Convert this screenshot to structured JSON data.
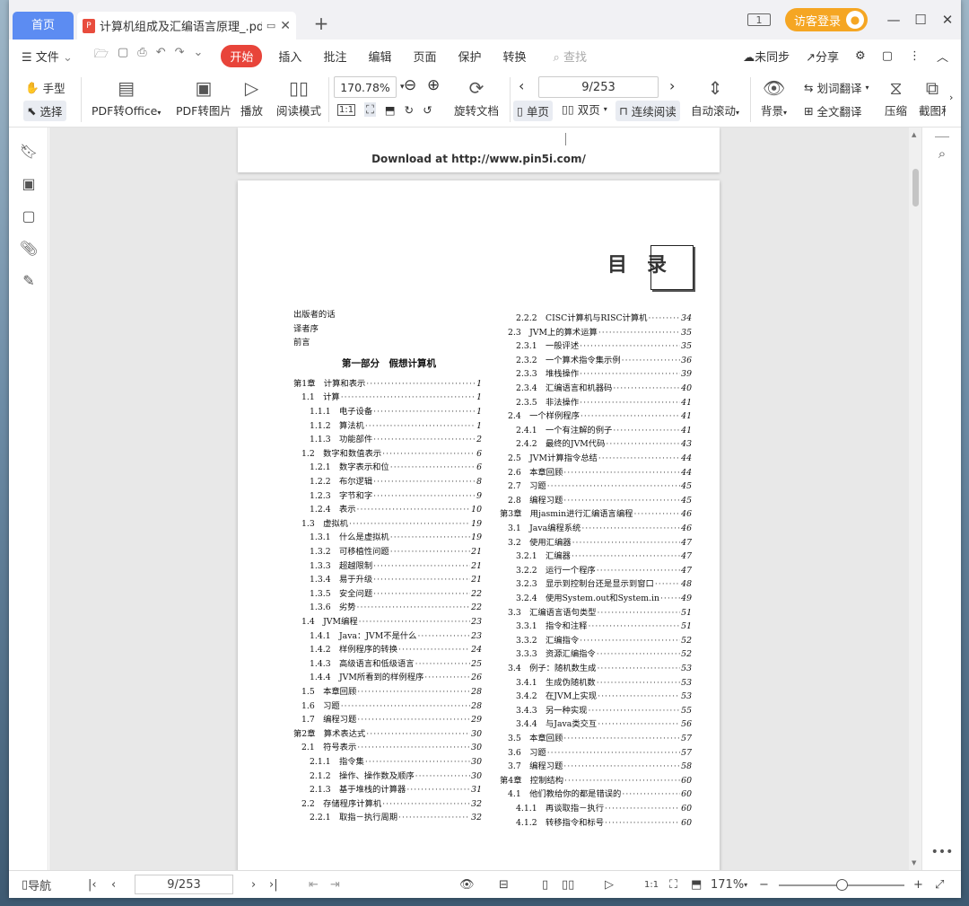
{
  "titlebar": {
    "home_tab": "首页",
    "doc_tab": "计算机组成及汇编语言原理_.pdf",
    "new_tab": "+",
    "page_badge": "1",
    "login": "访客登录"
  },
  "menubar": {
    "file": "文件",
    "start": "开始",
    "items": [
      "插入",
      "批注",
      "编辑",
      "页面",
      "保护",
      "转换"
    ],
    "search": "查找",
    "sync": "未同步",
    "share": "分享"
  },
  "toolbar": {
    "hand": "手型",
    "select": "选择",
    "pdf_to_office": "PDF转Office",
    "pdf_to_image": "PDF转图片",
    "play": "播放",
    "read_mode": "阅读模式",
    "zoom": "170.78%",
    "page": "9/253",
    "rotate": "旋转文档",
    "single": "单页",
    "double": "双页",
    "continuous": "连续阅读",
    "auto_scroll": "自动滚动",
    "background": "背景",
    "word_translate": "划词翻译",
    "full_translate": "全文翻译",
    "compress": "压缩",
    "screenshot": "截图和"
  },
  "document": {
    "prev_page_footer": "Download at http://www.pin5i.com/",
    "heading": "目　录",
    "toc_left": [
      {
        "t": "出版者的话",
        "p": "",
        "i": 0
      },
      {
        "t": "译者序",
        "p": "",
        "i": 0
      },
      {
        "t": "前言",
        "p": "",
        "i": 0
      },
      {
        "t": "第1章　计算和表示",
        "p": "1",
        "i": 0
      },
      {
        "t": "1.1　计算",
        "p": "1",
        "i": 1
      },
      {
        "t": "1.1.1　电子设备",
        "p": "1",
        "i": 2
      },
      {
        "t": "1.1.2　算法机",
        "p": "1",
        "i": 2
      },
      {
        "t": "1.1.3　功能部件",
        "p": "2",
        "i": 2
      },
      {
        "t": "1.2　数字和数值表示",
        "p": "6",
        "i": 1
      },
      {
        "t": "1.2.1　数字表示和位",
        "p": "6",
        "i": 2
      },
      {
        "t": "1.2.2　布尔逻辑",
        "p": "8",
        "i": 2
      },
      {
        "t": "1.2.3　字节和字",
        "p": "9",
        "i": 2
      },
      {
        "t": "1.2.4　表示",
        "p": "10",
        "i": 2
      },
      {
        "t": "1.3　虚拟机",
        "p": "19",
        "i": 1
      },
      {
        "t": "1.3.1　什么是虚拟机",
        "p": "19",
        "i": 2
      },
      {
        "t": "1.3.2　可移植性问题",
        "p": "21",
        "i": 2
      },
      {
        "t": "1.3.3　超越限制",
        "p": "21",
        "i": 2
      },
      {
        "t": "1.3.4　易于升级",
        "p": "21",
        "i": 2
      },
      {
        "t": "1.3.5　安全问题",
        "p": "22",
        "i": 2
      },
      {
        "t": "1.3.6　劣势",
        "p": "22",
        "i": 2
      },
      {
        "t": "1.4　JVM编程",
        "p": "23",
        "i": 1
      },
      {
        "t": "1.4.1　Java：JVM不是什么",
        "p": "23",
        "i": 2
      },
      {
        "t": "1.4.2　样例程序的转换",
        "p": "24",
        "i": 2
      },
      {
        "t": "1.4.3　高级语言和低级语言",
        "p": "25",
        "i": 2
      },
      {
        "t": "1.4.4　JVM所看到的样例程序",
        "p": "26",
        "i": 2
      },
      {
        "t": "1.5　本章回顾",
        "p": "28",
        "i": 1
      },
      {
        "t": "1.6　习题",
        "p": "28",
        "i": 1
      },
      {
        "t": "1.7　编程习题",
        "p": "29",
        "i": 1
      },
      {
        "t": "第2章　算术表达式",
        "p": "30",
        "i": 0
      },
      {
        "t": "2.1　符号表示",
        "p": "30",
        "i": 1
      },
      {
        "t": "2.1.1　指令集",
        "p": "30",
        "i": 2
      },
      {
        "t": "2.1.2　操作、操作数及顺序",
        "p": "30",
        "i": 2
      },
      {
        "t": "2.1.3　基于堆栈的计算器",
        "p": "31",
        "i": 2
      },
      {
        "t": "2.2　存储程序计算机",
        "p": "32",
        "i": 1
      },
      {
        "t": "2.2.1　取指－执行周期",
        "p": "32",
        "i": 2
      }
    ],
    "part1": "第一部分　假想计算机",
    "toc_right": [
      {
        "t": "2.2.2　CISC计算机与RISC计算机",
        "p": "34",
        "i": 2
      },
      {
        "t": "2.3　JVM上的算术运算",
        "p": "35",
        "i": 1
      },
      {
        "t": "2.3.1　一般评述",
        "p": "35",
        "i": 2
      },
      {
        "t": "2.3.2　一个算术指令集示例",
        "p": "36",
        "i": 2
      },
      {
        "t": "2.3.3　堆栈操作",
        "p": "39",
        "i": 2
      },
      {
        "t": "2.3.4　汇编语言和机器码",
        "p": "40",
        "i": 2
      },
      {
        "t": "2.3.5　非法操作",
        "p": "41",
        "i": 2
      },
      {
        "t": "2.4　一个样例程序",
        "p": "41",
        "i": 1
      },
      {
        "t": "2.4.1　一个有注解的例子",
        "p": "41",
        "i": 2
      },
      {
        "t": "2.4.2　最终的JVM代码",
        "p": "43",
        "i": 2
      },
      {
        "t": "2.5　JVM计算指令总结",
        "p": "44",
        "i": 1
      },
      {
        "t": "2.6　本章回顾",
        "p": "44",
        "i": 1
      },
      {
        "t": "2.7　习题",
        "p": "45",
        "i": 1
      },
      {
        "t": "2.8　编程习题",
        "p": "45",
        "i": 1
      },
      {
        "t": "第3章　用jasmin进行汇编语言编程",
        "p": "46",
        "i": 0
      },
      {
        "t": "3.1　Java编程系统",
        "p": "46",
        "i": 1
      },
      {
        "t": "3.2　使用汇编器",
        "p": "47",
        "i": 1
      },
      {
        "t": "3.2.1　汇编器",
        "p": "47",
        "i": 2
      },
      {
        "t": "3.2.2　运行一个程序",
        "p": "47",
        "i": 2
      },
      {
        "t": "3.2.3　显示到控制台还是显示到窗口",
        "p": "48",
        "i": 2
      },
      {
        "t": "3.2.4　使用System.out和System.in",
        "p": "49",
        "i": 2
      },
      {
        "t": "3.3　汇编语言语句类型",
        "p": "51",
        "i": 1
      },
      {
        "t": "3.3.1　指令和注释",
        "p": "51",
        "i": 2
      },
      {
        "t": "3.3.2　汇编指令",
        "p": "52",
        "i": 2
      },
      {
        "t": "3.3.3　资源汇编指令",
        "p": "52",
        "i": 2
      },
      {
        "t": "3.4　例子：随机数生成",
        "p": "53",
        "i": 1
      },
      {
        "t": "3.4.1　生成伪随机数",
        "p": "53",
        "i": 2
      },
      {
        "t": "3.4.2　在JVM上实现",
        "p": "53",
        "i": 2
      },
      {
        "t": "3.4.3　另一种实现",
        "p": "55",
        "i": 2
      },
      {
        "t": "3.4.4　与Java类交互",
        "p": "56",
        "i": 2
      },
      {
        "t": "3.5　本章回顾",
        "p": "57",
        "i": 1
      },
      {
        "t": "3.6　习题",
        "p": "57",
        "i": 1
      },
      {
        "t": "3.7　编程习题",
        "p": "58",
        "i": 1
      },
      {
        "t": "第4章　控制结构",
        "p": "60",
        "i": 0
      },
      {
        "t": "4.1　他们教给你的都是错误的",
        "p": "60",
        "i": 1
      },
      {
        "t": "4.1.1　再谈取指－执行",
        "p": "60",
        "i": 2
      },
      {
        "t": "4.1.2　转移指令和标号",
        "p": "60",
        "i": 2
      }
    ]
  },
  "statusbar": {
    "nav": "导航",
    "page": "9/253",
    "zoom": "171%",
    "zoom_level": 0.5
  }
}
